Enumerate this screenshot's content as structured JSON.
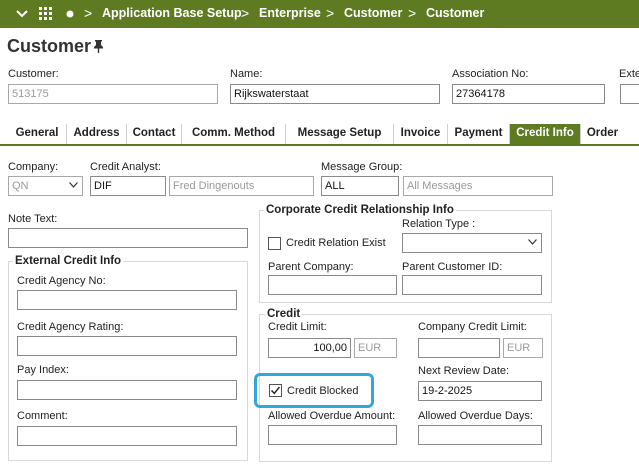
{
  "topbar": {
    "nav_icons": [
      "chevron-down-icon",
      "grid-menu-icon",
      "dot-icon"
    ],
    "breadcrumbs": [
      "Application Base Setup",
      "Enterprise",
      "Customer",
      "Customer"
    ]
  },
  "page": {
    "title": "Customer",
    "pin_icon": "pin-icon"
  },
  "header": {
    "customer_label": "Customer:",
    "customer_value": "513175",
    "name_label": "Name:",
    "name_value": "Rijkswaterstaat",
    "association_label": "Association No:",
    "association_value": "27364178",
    "extra_label": "Exte"
  },
  "tabs": [
    "General",
    "Address",
    "Contact",
    "Comm. Method",
    "Message Setup",
    "Invoice",
    "Payment",
    "Credit Info",
    "Order"
  ],
  "active_tab": "Credit Info",
  "credit_form": {
    "company_label": "Company:",
    "company_value": "QN",
    "credit_analyst_label": "Credit Analyst:",
    "credit_analyst_value": "DIF",
    "credit_analyst_name": "Fred Dingenouts",
    "message_group_label": "Message Group:",
    "message_group_value": "ALL",
    "message_group_desc": "All Messages",
    "note_text_label": "Note Text:"
  },
  "external_credit": {
    "title": "External Credit Info",
    "agency_no_label": "Credit Agency No:",
    "agency_rating_label": "Credit Agency Rating:",
    "pay_index_label": "Pay Index:",
    "comment_label": "Comment:"
  },
  "corporate": {
    "title": "Corporate Credit Relationship Info",
    "credit_relation_label": "Credit Relation Exist",
    "relation_type_label": "Relation Type :",
    "parent_company_label": "Parent Company:",
    "parent_customer_label": "Parent Customer ID:"
  },
  "credit": {
    "title": "Credit",
    "credit_limit_label": "Credit Limit:",
    "credit_limit_value": "100,00",
    "currency": "EUR",
    "company_credit_limit_label": "Company Credit Limit:",
    "company_currency": "EUR",
    "credit_blocked_label": "Credit Blocked",
    "credit_blocked_checked": true,
    "next_review_label": "Next Review Date:",
    "next_review_value": "19-2-2025",
    "allowed_overdue_amount_label": "Allowed Overdue Amount:",
    "allowed_overdue_days_label": "Allowed Overdue Days:"
  }
}
